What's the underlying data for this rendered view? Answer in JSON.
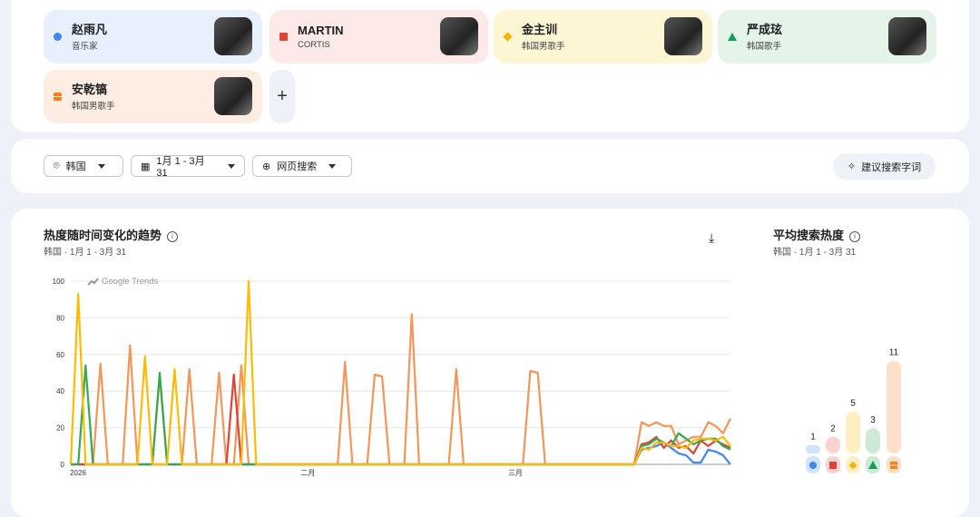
{
  "terms": [
    {
      "name": "赵雨凡",
      "sub": "音乐家",
      "color": "#4285f4",
      "bg": "#e9f0fd",
      "shape": "circle"
    },
    {
      "name": "MARTIN",
      "sub": "CORTIS",
      "color": "#db4437",
      "bg": "#fce9e8",
      "shape": "square"
    },
    {
      "name": "金主训",
      "sub": "韩国男歌手",
      "color": "#f4b400",
      "bg": "#fdf6d4",
      "shape": "diamond"
    },
    {
      "name": "严成玹",
      "sub": "韩国歌手",
      "color": "#0f9d58",
      "bg": "#e4f4e9",
      "shape": "triangle"
    },
    {
      "name": "安乾镐",
      "sub": "韩国男歌手",
      "color": "#ff7d17",
      "bg": "#feede2",
      "shape": "split-square"
    }
  ],
  "add_label": "+",
  "filters": {
    "region": "韩国",
    "date": "1月 1 - 3月 31",
    "type": "网页搜索",
    "suggest": "建议搜索字词"
  },
  "trend": {
    "title": "热度随时间变化的趋势",
    "subtitle": "韩国 · 1月 1 - 3月 31",
    "watermark": "Google Trends"
  },
  "avg": {
    "title": "平均搜索热度",
    "subtitle": "韩国 · 1月 1 - 3月 31"
  },
  "chart_data": {
    "type": "line",
    "x_start": "2026-01-01",
    "x_end": "2026-03-31",
    "interval": "day",
    "xticks": [
      {
        "day": 0,
        "label": "2026"
      },
      {
        "day": 31,
        "label": "二月"
      },
      {
        "day": 59,
        "label": "三月"
      }
    ],
    "yticks": [
      0,
      20,
      40,
      60,
      80,
      100
    ],
    "ylim": [
      0,
      100
    ],
    "grid": true,
    "series": [
      {
        "name": "赵雨凡",
        "color": "#4285f4",
        "values": [
          0,
          0,
          0,
          0,
          0,
          0,
          0,
          0,
          0,
          0,
          0,
          0,
          0,
          0,
          0,
          0,
          0,
          0,
          0,
          0,
          0,
          0,
          0,
          0,
          0,
          0,
          0,
          0,
          0,
          0,
          0,
          0,
          0,
          0,
          0,
          0,
          0,
          0,
          0,
          0,
          0,
          0,
          0,
          0,
          0,
          0,
          0,
          0,
          0,
          0,
          0,
          0,
          0,
          0,
          0,
          0,
          0,
          0,
          0,
          0,
          0,
          0,
          0,
          0,
          0,
          0,
          0,
          0,
          0,
          0,
          0,
          0,
          0,
          0,
          0,
          0,
          0,
          8,
          9,
          10,
          12,
          9,
          6,
          5,
          1,
          1,
          8,
          7,
          5,
          0
        ]
      },
      {
        "name": "MARTIN",
        "color": "#db4437",
        "values": [
          0,
          0,
          0,
          0,
          0,
          0,
          0,
          0,
          0,
          0,
          0,
          0,
          0,
          0,
          0,
          0,
          0,
          0,
          0,
          0,
          0,
          0,
          49,
          0,
          0,
          0,
          0,
          0,
          0,
          0,
          0,
          0,
          0,
          0,
          0,
          0,
          0,
          0,
          0,
          0,
          0,
          0,
          0,
          0,
          0,
          0,
          0,
          0,
          0,
          0,
          0,
          0,
          0,
          0,
          0,
          0,
          0,
          0,
          0,
          0,
          0,
          0,
          0,
          0,
          0,
          0,
          0,
          0,
          0,
          0,
          0,
          0,
          0,
          0,
          0,
          0,
          0,
          11,
          12,
          15,
          9,
          13,
          9,
          10,
          6,
          13,
          10,
          13,
          11,
          9
        ]
      },
      {
        "name": "金主训",
        "color": "#fbbc04",
        "values": [
          0,
          93,
          0,
          0,
          0,
          0,
          0,
          0,
          0,
          0,
          59,
          0,
          0,
          0,
          52,
          0,
          0,
          0,
          0,
          0,
          0,
          0,
          0,
          0,
          100,
          0,
          0,
          0,
          0,
          0,
          0,
          0,
          0,
          0,
          0,
          0,
          0,
          0,
          0,
          0,
          0,
          0,
          0,
          0,
          0,
          0,
          0,
          0,
          0,
          0,
          0,
          0,
          0,
          0,
          0,
          0,
          0,
          0,
          0,
          0,
          0,
          0,
          0,
          0,
          0,
          0,
          0,
          0,
          0,
          0,
          0,
          0,
          0,
          0,
          0,
          0,
          0,
          9,
          8,
          12,
          12,
          10,
          10,
          9,
          13,
          14,
          14,
          13,
          15,
          10
        ]
      },
      {
        "name": "严成玹",
        "color": "#34a853",
        "values": [
          0,
          0,
          54,
          0,
          0,
          0,
          0,
          0,
          0,
          0,
          0,
          0,
          50,
          0,
          0,
          0,
          0,
          0,
          0,
          0,
          0,
          0,
          0,
          0,
          0,
          0,
          0,
          0,
          0,
          0,
          0,
          0,
          0,
          0,
          0,
          0,
          0,
          0,
          0,
          0,
          0,
          0,
          0,
          0,
          0,
          0,
          0,
          0,
          0,
          0,
          0,
          0,
          0,
          0,
          0,
          0,
          0,
          0,
          0,
          0,
          0,
          0,
          0,
          0,
          0,
          0,
          0,
          0,
          0,
          0,
          0,
          0,
          0,
          0,
          0,
          0,
          0,
          10,
          11,
          14,
          12,
          10,
          17,
          14,
          11,
          13,
          14,
          14,
          10,
          8
        ]
      },
      {
        "name": "安乾镐",
        "color": "#f4955a",
        "values": [
          0,
          0,
          0,
          0,
          55,
          0,
          0,
          0,
          65,
          0,
          0,
          0,
          48,
          0,
          0,
          0,
          52,
          0,
          0,
          0,
          50,
          0,
          0,
          54,
          0,
          0,
          0,
          0,
          0,
          0,
          0,
          0,
          0,
          0,
          0,
          0,
          0,
          56,
          0,
          0,
          0,
          49,
          48,
          0,
          0,
          0,
          82,
          0,
          0,
          0,
          0,
          0,
          52,
          0,
          0,
          0,
          0,
          0,
          0,
          0,
          0,
          0,
          51,
          50,
          0,
          0,
          0,
          0,
          0,
          0,
          0,
          0,
          0,
          0,
          0,
          0,
          0,
          23,
          21,
          23,
          21,
          21,
          11,
          13,
          15,
          15,
          23,
          21,
          17,
          25
        ]
      }
    ]
  },
  "avg_chart": {
    "type": "bar",
    "categories": [
      "赵雨凡",
      "MARTIN",
      "金主训",
      "严成玹",
      "安乾镐"
    ],
    "values": [
      1,
      2,
      5,
      3,
      11
    ]
  }
}
